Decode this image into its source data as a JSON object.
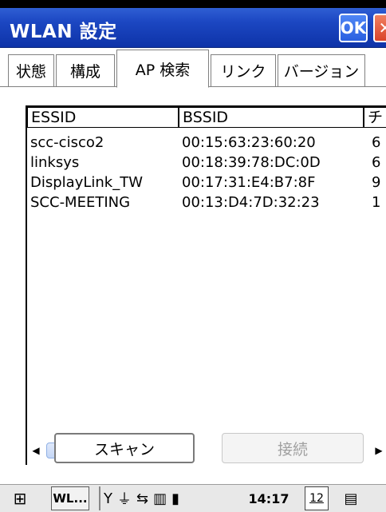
{
  "window": {
    "title": "WLAN 設定",
    "ok_label": "OK",
    "close_label": "✕"
  },
  "tabs": [
    {
      "label": "状態"
    },
    {
      "label": "構成"
    },
    {
      "label": "AP 検索",
      "active": true
    },
    {
      "label": "リンク"
    },
    {
      "label": "バージョン"
    }
  ],
  "list": {
    "columns": [
      "ESSID",
      "BSSID",
      "チ"
    ],
    "rows": [
      [
        "scc-cisco2",
        "00:15:63:23:60:20",
        "6"
      ],
      [
        "linksys",
        "00:18:39:78:DC:0D",
        "6"
      ],
      [
        "DisplayLink_TW",
        "00:17:31:E4:B7:8F",
        "9"
      ],
      [
        "SCC-MEETING",
        "00:13:D4:7D:32:23",
        "1"
      ]
    ]
  },
  "buttons": {
    "scan": "スキャン",
    "connect": "接続"
  },
  "taskbar": {
    "app_label": "WL...",
    "time": "14:17",
    "date": "12"
  },
  "colors": {
    "titlebar": "#1c47c2",
    "ok_button": "#2a5fe0",
    "close_button": "#d9432a",
    "disabled_text": "#a0a0a0"
  }
}
